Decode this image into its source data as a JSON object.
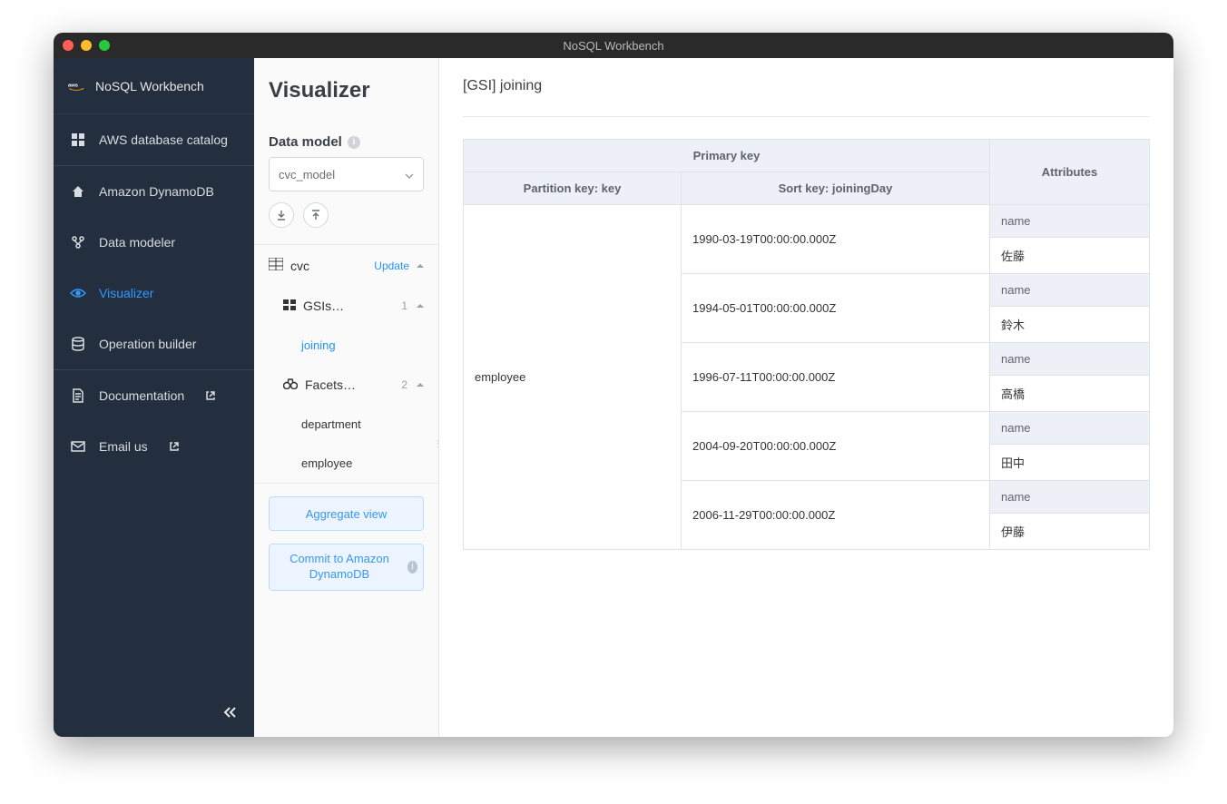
{
  "window": {
    "title": "NoSQL Workbench"
  },
  "brand": {
    "name": "NoSQL Workbench"
  },
  "sidebar": {
    "items": [
      {
        "label": "AWS database catalog"
      },
      {
        "label": "Amazon DynamoDB"
      },
      {
        "label": "Data modeler"
      },
      {
        "label": "Visualizer"
      },
      {
        "label": "Operation builder"
      },
      {
        "label": "Documentation"
      },
      {
        "label": "Email us"
      }
    ]
  },
  "panel2": {
    "heading": "Visualizer",
    "data_model_label": "Data model",
    "selected_model": "cvc_model",
    "table_name": "cvc",
    "update_link": "Update",
    "gsis_label": "GSIs…",
    "gsis_count": "1",
    "gsi_item": "joining",
    "facets_label": "Facets…",
    "facets_count": "2",
    "facet_items": [
      "department",
      "employee"
    ],
    "aggregate_btn": "Aggregate view",
    "commit_btn": "Commit to Amazon DynamoDB"
  },
  "main": {
    "title": "[GSI] joining",
    "headers": {
      "primary_key": "Primary key",
      "attributes": "Attributes",
      "partition_key": "Partition key: key",
      "sort_key": "Sort key: joiningDay"
    },
    "partition_value": "employee",
    "rows": [
      {
        "sort_key": "1990-03-19T00:00:00.000Z",
        "attr_name": "name",
        "attr_value": "佐藤"
      },
      {
        "sort_key": "1994-05-01T00:00:00.000Z",
        "attr_name": "name",
        "attr_value": "鈴木"
      },
      {
        "sort_key": "1996-07-11T00:00:00.000Z",
        "attr_name": "name",
        "attr_value": "高橋"
      },
      {
        "sort_key": "2004-09-20T00:00:00.000Z",
        "attr_name": "name",
        "attr_value": "田中"
      },
      {
        "sort_key": "2006-11-29T00:00:00.000Z",
        "attr_name": "name",
        "attr_value": "伊藤"
      }
    ]
  }
}
